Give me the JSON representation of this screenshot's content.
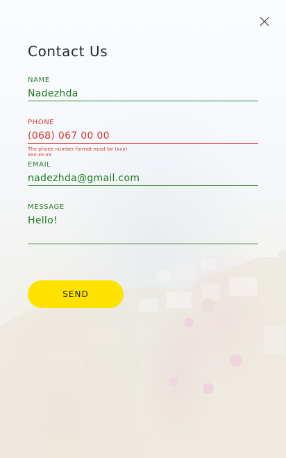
{
  "form": {
    "title": "Contact Us",
    "close_icon": "close-icon",
    "name": {
      "label": "NAME",
      "value": "Nadezhda"
    },
    "phone": {
      "label": "PHONE",
      "value": "(068) 067 00 00",
      "error": "The phone number format must be (xxx) xxx-xx-xx"
    },
    "email": {
      "label": "EMAIL",
      "value": "nadezhda@gmail.com"
    },
    "message": {
      "label": "MESSAGE",
      "value": "Hello!"
    },
    "send_label": "SEND"
  },
  "colors": {
    "valid": "#2e7d32",
    "error": "#d8342f",
    "button": "#ffe200"
  }
}
